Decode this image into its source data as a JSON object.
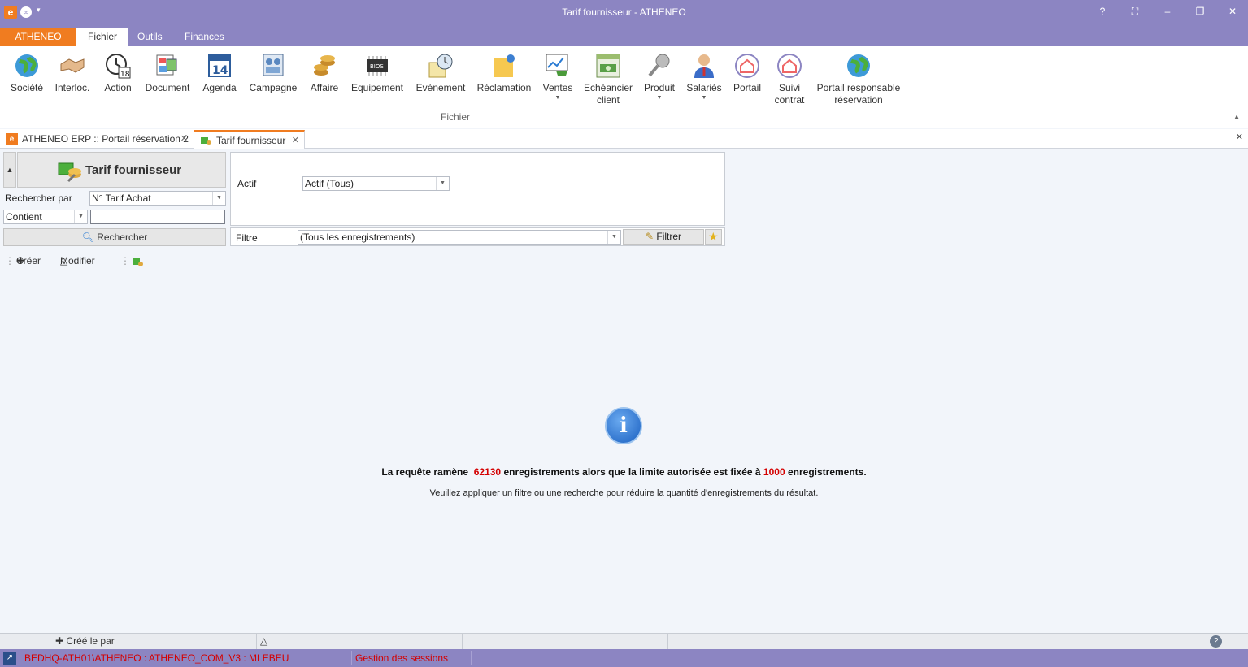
{
  "window": {
    "title": "Tarif fournisseur - ATHENEO"
  },
  "ribbon_tabs": [
    "ATHENEO",
    "Fichier",
    "Outils",
    "Finances"
  ],
  "ribbon": {
    "buttons": [
      {
        "label": "Société",
        "icon": "globe-icon"
      },
      {
        "label": "Interloc.",
        "icon": "handshake-icon"
      },
      {
        "label": "Action",
        "icon": "clock-calendar-icon"
      },
      {
        "label": "Document",
        "icon": "document-icon"
      },
      {
        "label": "Agenda",
        "icon": "calendar-icon",
        "day": "14"
      },
      {
        "label": "Campagne",
        "icon": "campaign-icon"
      },
      {
        "label": "Affaire",
        "icon": "coins-icon"
      },
      {
        "label": "Equipement",
        "icon": "chip-icon",
        "chip_text": "BIOS"
      },
      {
        "label": "Evènement",
        "icon": "event-clock-icon"
      },
      {
        "label": "Réclamation",
        "icon": "note-pin-icon"
      },
      {
        "label": "Ventes",
        "icon": "cart-chart-icon"
      },
      {
        "label": "Echéancier client",
        "icon": "schedule-money-icon"
      },
      {
        "label": "Produit",
        "icon": "product-icon"
      },
      {
        "label": "Salariés",
        "icon": "employee-icon"
      },
      {
        "label": "Portail",
        "icon": "home-circle-icon"
      },
      {
        "label": "Suivi contrat",
        "icon": "home-circle-icon"
      },
      {
        "label": "Portail responsable réservation",
        "icon": "globe-icon"
      }
    ],
    "group_label": "Fichier"
  },
  "doc_tabs": [
    {
      "label": "ATHENEO ERP :: Portail réservation 2"
    },
    {
      "label": "Tarif fournisseur"
    }
  ],
  "panel": {
    "title": "Tarif fournisseur",
    "search_by_label": "Rechercher par",
    "search_by_value": "N° Tarif Achat",
    "operator_value": "Contient",
    "search_text": "",
    "search_button": "Rechercher"
  },
  "toolbar": {
    "create_label": "Créer",
    "modify_label": "Modifier"
  },
  "filters": {
    "actif_label": "Actif",
    "actif_value": "Actif (Tous)",
    "filtre_label": "Filtre",
    "filtre_value": "(Tous les enregistrements)",
    "filtrer_button": "Filtrer"
  },
  "message": {
    "part1": "La requête ramène",
    "count": "62130",
    "part2": "enregistrements alors que la limite autorisée est fixée à",
    "limit": "1000",
    "part3": "enregistrements.",
    "hint": "Veuillez appliquer un filtre ou une recherche pour réduire la quantité d'enregistrements du résultat."
  },
  "bottombar": {
    "created_label": "Créé le  par"
  },
  "statusbar": {
    "connection": "BEDHQ-ATH01\\ATHENEO : ATHENEO_COM_V3 : MLEBEU",
    "sessions": "Gestion des sessions"
  },
  "colors": {
    "chrome": "#8c85c2",
    "brand": "#f07c20",
    "alert": "#d40000"
  }
}
